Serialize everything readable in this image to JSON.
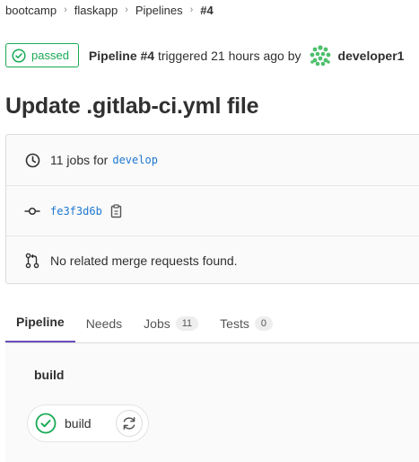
{
  "breadcrumb": {
    "items": [
      "bootcamp",
      "flaskapp",
      "Pipelines",
      "#4"
    ],
    "separator": "›"
  },
  "header": {
    "status": "passed",
    "pipeline_label": "Pipeline #4",
    "triggered_text": "triggered 21 hours ago by",
    "user": "developer1"
  },
  "title": "Update .gitlab-ci.yml file",
  "info": {
    "jobs_text": "11 jobs for",
    "branch": "develop",
    "commit_sha": "fe3f3d6b",
    "merge_requests": "No related merge requests found."
  },
  "tabs": [
    {
      "label": "Pipeline",
      "count": null,
      "active": true
    },
    {
      "label": "Needs",
      "count": null,
      "active": false
    },
    {
      "label": "Jobs",
      "count": "11",
      "active": false
    },
    {
      "label": "Tests",
      "count": "0",
      "active": false
    }
  ],
  "pipeline": {
    "stage": "build",
    "job": "build"
  },
  "colors": {
    "success": "#1aaa55",
    "link": "#1f78d1",
    "active_tab": "#6b4fbb"
  },
  "icons": {
    "status": "check-circle-icon",
    "clock": "clock-icon",
    "commit": "commit-icon",
    "copy": "clipboard-icon",
    "merge_request": "merge-request-icon",
    "retry": "retry-icon"
  }
}
